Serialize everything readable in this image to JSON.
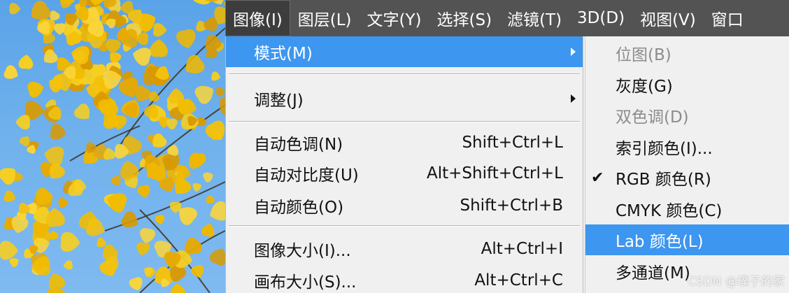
{
  "menubar": {
    "items": [
      {
        "label": "图像(I)",
        "active": true
      },
      {
        "label": "图层(L)"
      },
      {
        "label": "文字(Y)"
      },
      {
        "label": "选择(S)"
      },
      {
        "label": "滤镜(T)"
      },
      {
        "label": "3D(D)"
      },
      {
        "label": "视图(V)"
      },
      {
        "label": "窗口"
      }
    ]
  },
  "image_menu": {
    "mode": {
      "label": "模式(M)"
    },
    "adjust": {
      "label": "调整(J)"
    },
    "auto_tone": {
      "label": "自动色调(N)",
      "shortcut": "Shift+Ctrl+L"
    },
    "auto_contrast": {
      "label": "自动对比度(U)",
      "shortcut": "Alt+Shift+Ctrl+L"
    },
    "auto_color": {
      "label": "自动颜色(O)",
      "shortcut": "Shift+Ctrl+B"
    },
    "image_size": {
      "label": "图像大小(I)...",
      "shortcut": "Alt+Ctrl+I"
    },
    "canvas_size": {
      "label": "画布大小(S)...",
      "shortcut": "Alt+Ctrl+C"
    }
  },
  "mode_submenu": {
    "bitmap": {
      "label": "位图(B)",
      "enabled": false
    },
    "grayscale": {
      "label": "灰度(G)",
      "enabled": true
    },
    "duotone": {
      "label": "双色调(D)",
      "enabled": false
    },
    "indexed": {
      "label": "索引颜色(I)...",
      "enabled": true
    },
    "rgb": {
      "label": "RGB 颜色(R)",
      "checked": true
    },
    "cmyk": {
      "label": "CMYK 颜色(C)",
      "enabled": true
    },
    "lab": {
      "label": "Lab 颜色(L)",
      "highlighted": true
    },
    "multichannel": {
      "label": "多通道(M)",
      "enabled": true
    }
  },
  "icons": {
    "checkmark": "✔"
  },
  "colors": {
    "menubar_bg": "#535353",
    "highlight": "#3d96ef",
    "menu_bg": "#f0f0f0",
    "disabled_text": "#8c8c8c"
  },
  "watermark": "CSDN @璞子的家"
}
